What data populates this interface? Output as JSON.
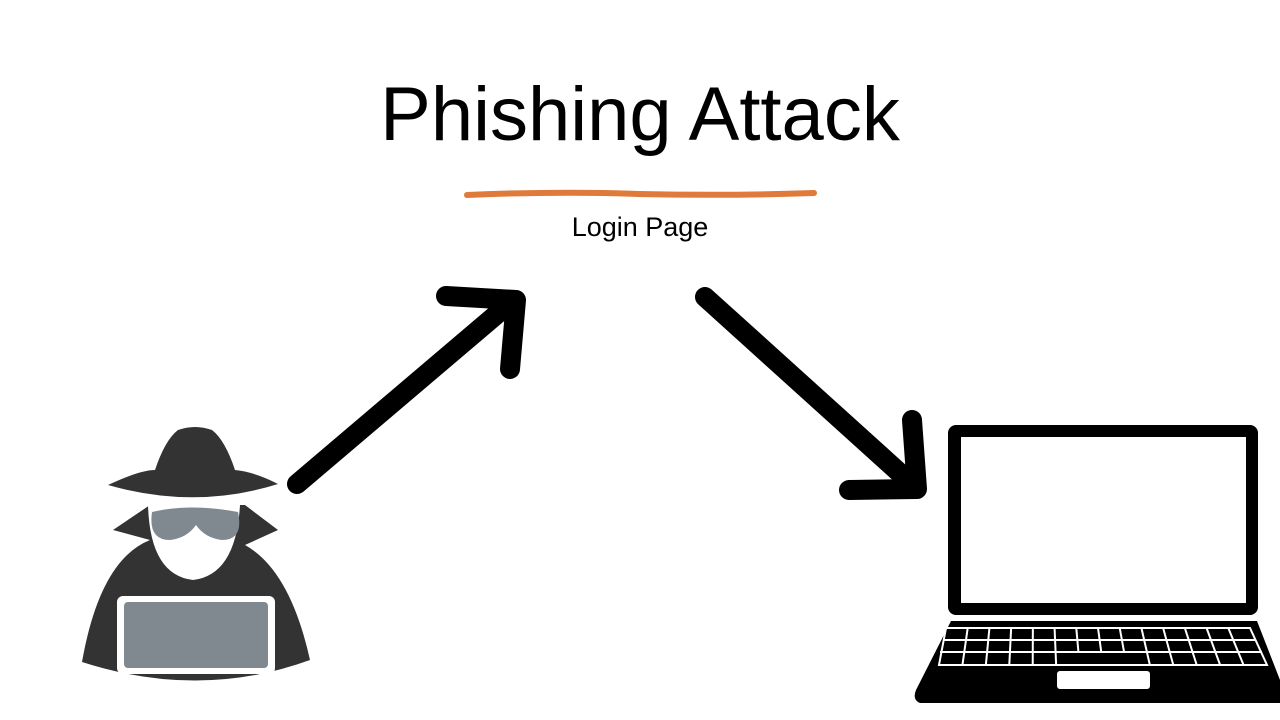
{
  "slide": {
    "title": "Phishing Attack",
    "subtitle": "Login Page",
    "accent_color": "#E07A3A"
  },
  "icons": {
    "attacker": "hacker-icon",
    "victim": "laptop-icon",
    "arrow_to_page": "arrow-up-right-icon",
    "arrow_to_victim": "arrow-down-right-icon"
  }
}
